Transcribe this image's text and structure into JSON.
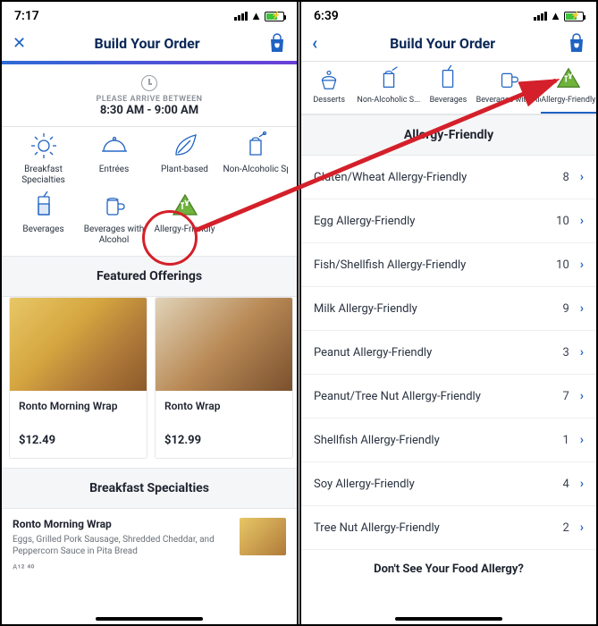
{
  "left": {
    "status_time": "7:17",
    "header_title": "Build Your Order",
    "arrive_label": "PLEASE ARRIVE BETWEEN",
    "arrive_time": "8:30 AM - 9:00 AM",
    "categories": [
      {
        "label": "Breakfast Specialties",
        "icon": "sun"
      },
      {
        "label": "Entrées",
        "icon": "cloche"
      },
      {
        "label": "Plant-based",
        "icon": "leaf"
      },
      {
        "label": "Non-Alcoholic Specialty Be",
        "icon": "tiki"
      },
      {
        "label": "Beverages",
        "icon": "glass"
      },
      {
        "label": "Beverages with Alcohol",
        "icon": "beer"
      },
      {
        "label": "Allergy-Friendly",
        "icon": "allergy"
      }
    ],
    "section_featured": "Featured Offerings",
    "featured": [
      {
        "name": "Ronto Morning Wrap",
        "price": "$12.49"
      },
      {
        "name": "Ronto Wrap",
        "price": "$12.99"
      }
    ],
    "section_breakfast": "Breakfast Specialties",
    "breakfast_item": {
      "name": "Ronto Morning Wrap",
      "desc": "Eggs, Grilled Pork Sausage, Shredded Cheddar, and Peppercorn Sauce in Pita Bread",
      "price_partial": "$12.49"
    }
  },
  "right": {
    "status_time": "6:39",
    "header_title": "Build Your Order",
    "strip": [
      {
        "label": "Desserts",
        "icon": "cupcake"
      },
      {
        "label": "Non-Alcoholic S...",
        "icon": "tiki"
      },
      {
        "label": "Beverages",
        "icon": "glass"
      },
      {
        "label": "Beverages with Alcohol",
        "icon": "beer"
      },
      {
        "label": "Allergy-Friendly",
        "icon": "allergy",
        "active": true
      }
    ],
    "section_title": "Allergy-Friendly",
    "rows": [
      {
        "label": "Gluten/Wheat Allergy-Friendly",
        "count": 8
      },
      {
        "label": "Egg Allergy-Friendly",
        "count": 10
      },
      {
        "label": "Fish/Shellfish Allergy-Friendly",
        "count": 10
      },
      {
        "label": "Milk Allergy-Friendly",
        "count": 9
      },
      {
        "label": "Peanut Allergy-Friendly",
        "count": 3
      },
      {
        "label": "Peanut/Tree Nut Allergy-Friendly",
        "count": 7
      },
      {
        "label": "Shellfish Allergy-Friendly",
        "count": 1
      },
      {
        "label": "Soy Allergy-Friendly",
        "count": 4
      },
      {
        "label": "Tree Nut Allergy-Friendly",
        "count": 2
      }
    ],
    "dont_see": "Don't See Your Food Allergy?"
  }
}
